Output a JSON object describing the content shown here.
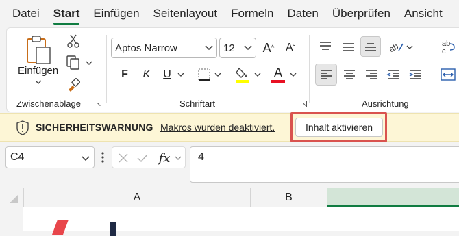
{
  "menu": {
    "items": [
      "Datei",
      "Start",
      "Einfügen",
      "Seitenlayout",
      "Formeln",
      "Daten",
      "Überprüfen",
      "Ansicht"
    ],
    "active_index": 1
  },
  "ribbon": {
    "clipboard": {
      "paste_label": "Einfügen",
      "group_label": "Zwischenablage"
    },
    "font": {
      "font_name": "Aptos Narrow",
      "font_size": "12",
      "bold_label": "F",
      "italic_label": "K",
      "underline_label": "U",
      "font_color_letter": "A",
      "font_color": "#e81123",
      "highlight_color": "#ffff00",
      "group_label": "Schriftart"
    },
    "alignment": {
      "group_label": "Ausrichtung"
    }
  },
  "security": {
    "title": "SICHERHEITSWARNUNG",
    "message": "Makros wurden deaktiviert.",
    "button_label": "Inhalt aktivieren"
  },
  "formula_bar": {
    "cell_ref": "C4",
    "fx_label": "fx",
    "value": "4"
  },
  "columns": [
    "A",
    "B"
  ],
  "colors": {
    "accent": "#107c41",
    "warning_bg": "#fdf6d6",
    "highlight_border": "#d9534f"
  }
}
